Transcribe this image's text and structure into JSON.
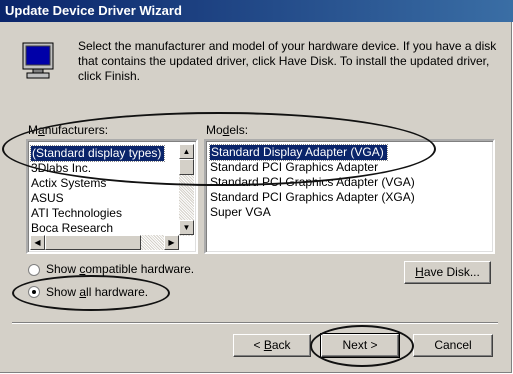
{
  "window": {
    "title": "Update Device Driver Wizard"
  },
  "instructions": "Select the manufacturer and model of your hardware device. If you have a disk that contains the updated driver, click Have Disk. To install the updated driver, click Finish.",
  "manufacturers": {
    "label_pre": "M",
    "label_key": "a",
    "label_post": "nufacturers:",
    "items": [
      "(Standard display types)",
      "3Dlabs Inc.",
      "Actix Systems",
      "ASUS",
      "ATI Technologies",
      "Boca Research"
    ],
    "selected_index": 0
  },
  "models": {
    "label_pre": "Mo",
    "label_key": "d",
    "label_post": "els:",
    "items": [
      "Standard Display Adapter (VGA)",
      "Standard PCI Graphics Adapter",
      "Standard PCI Graphics Adapter (VGA)",
      "Standard PCI Graphics Adapter (XGA)",
      "Super VGA"
    ],
    "selected_index": 0
  },
  "radios": {
    "compatible": {
      "pre": "Show ",
      "key": "c",
      "post": "ompatible hardware.",
      "checked": false
    },
    "all": {
      "pre": "Show ",
      "key": "a",
      "post": "ll hardware.",
      "checked": true
    }
  },
  "buttons": {
    "have_disk": {
      "key": "H",
      "post": "ave Disk..."
    },
    "back": {
      "pre": "< ",
      "key": "B",
      "post": "ack"
    },
    "next": "Next >",
    "cancel": "Cancel"
  },
  "icons": {
    "monitor": "monitor-icon",
    "scroll_up": "arrow-up-icon",
    "scroll_down": "arrow-down-icon",
    "scroll_left": "arrow-left-icon",
    "scroll_right": "arrow-right-icon"
  }
}
